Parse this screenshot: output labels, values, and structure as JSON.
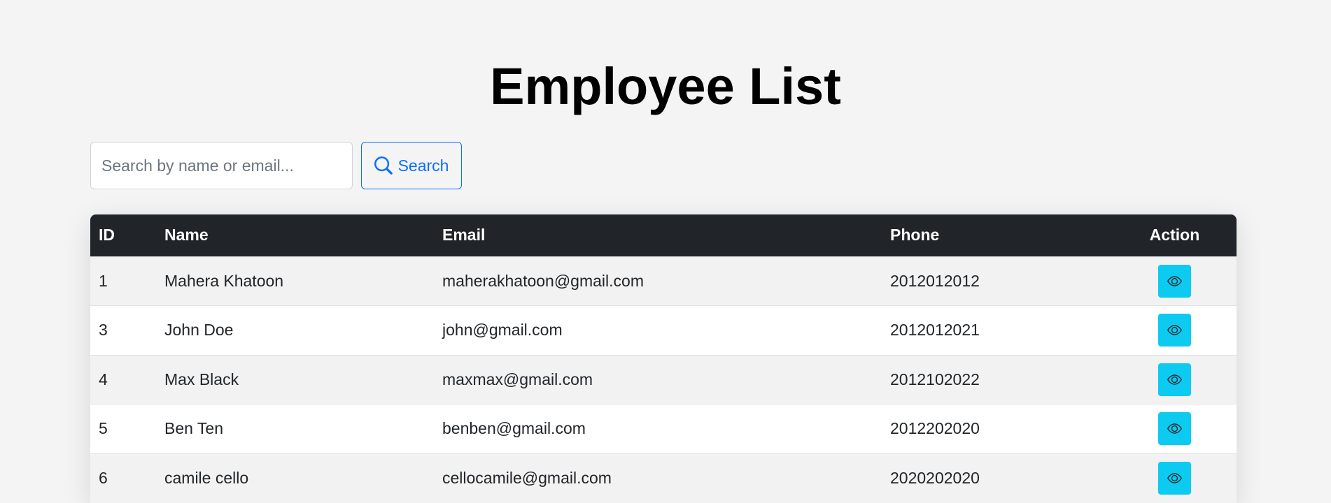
{
  "page": {
    "title": "Employee List"
  },
  "search": {
    "placeholder": "Search by name or email...",
    "value": "",
    "button_label": "Search",
    "button_icon": "search-icon"
  },
  "table": {
    "headers": {
      "id": "ID",
      "name": "Name",
      "email": "Email",
      "phone": "Phone",
      "action": "Action"
    },
    "rows": [
      {
        "id": "1",
        "name": "Mahera Khatoon",
        "email": "maherakhatoon@gmail.com",
        "phone": "2012012012",
        "action_icon": "eye-icon"
      },
      {
        "id": "3",
        "name": "John Doe",
        "email": "john@gmail.com",
        "phone": "2012012021",
        "action_icon": "eye-icon"
      },
      {
        "id": "4",
        "name": "Max Black",
        "email": "maxmax@gmail.com",
        "phone": "2012102022",
        "action_icon": "eye-icon"
      },
      {
        "id": "5",
        "name": "Ben Ten",
        "email": "benben@gmail.com",
        "phone": "2012202020",
        "action_icon": "eye-icon"
      },
      {
        "id": "6",
        "name": "camile cello",
        "email": "cellocamile@gmail.com",
        "phone": "2020202020",
        "action_icon": "eye-icon"
      }
    ]
  },
  "colors": {
    "background": "#f4f4f4",
    "header_bg": "#212529",
    "accent_primary": "#0d6efd",
    "view_button": "#0dcaf0"
  }
}
